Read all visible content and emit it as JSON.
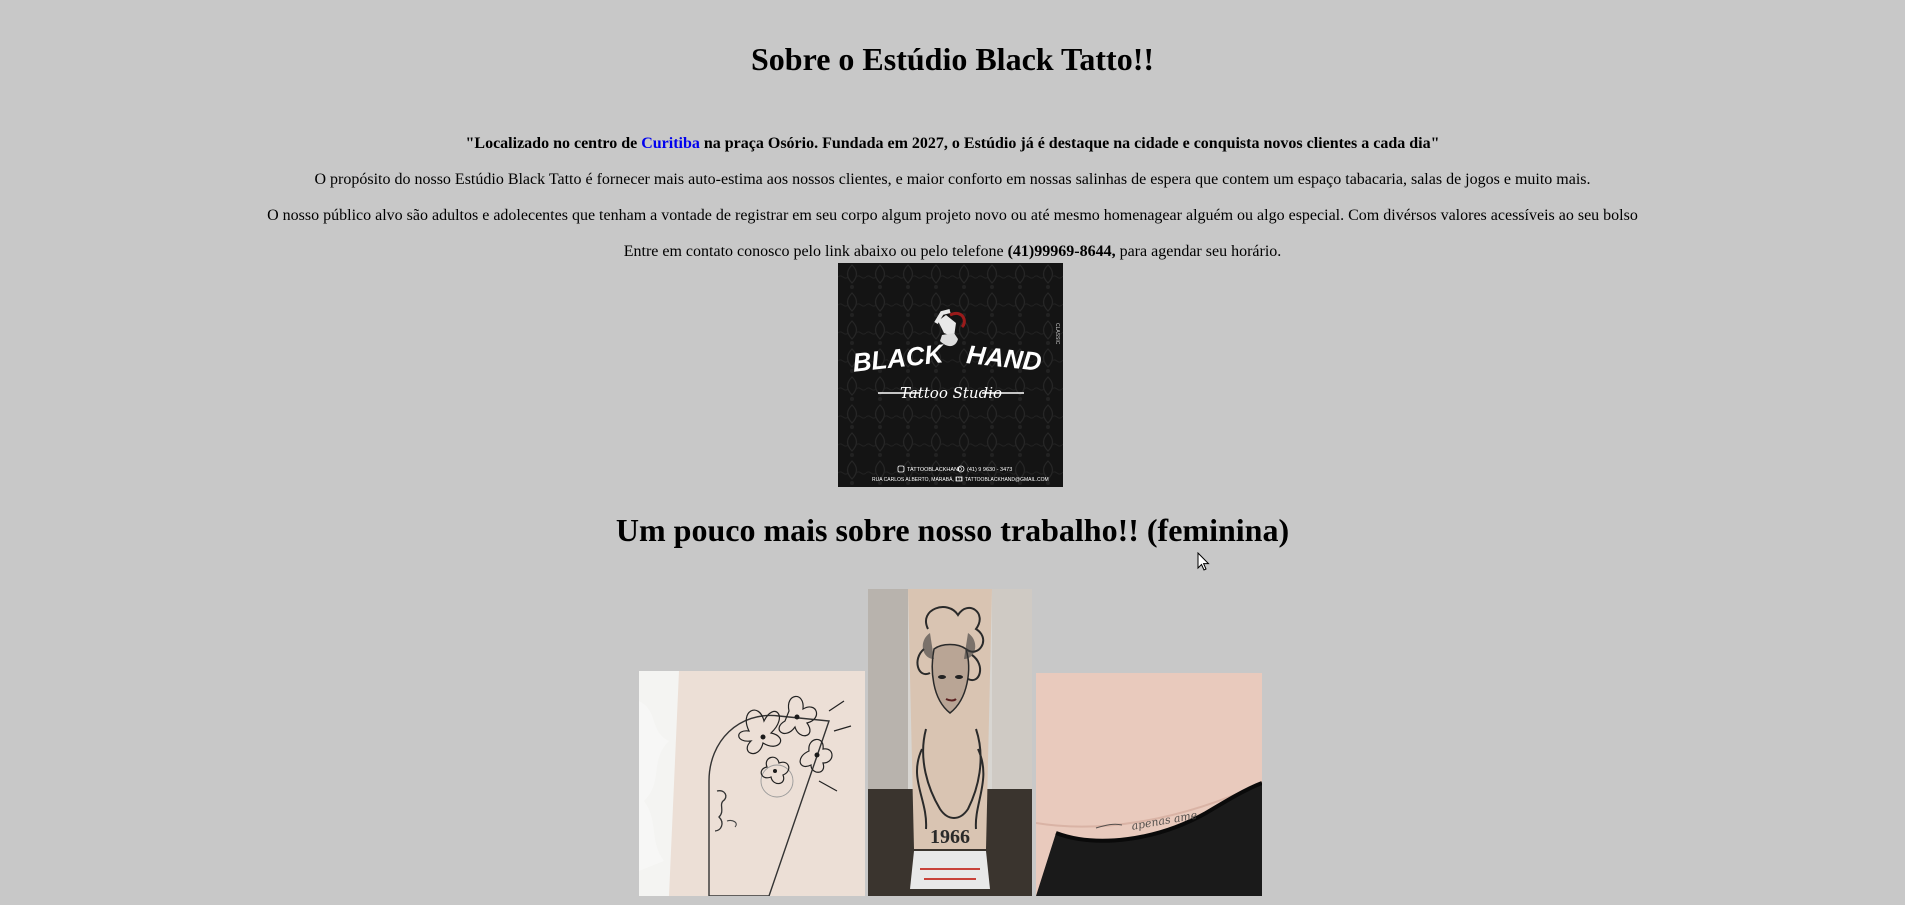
{
  "page": {
    "title": "Sobre o Estúdio Black Tatto!!",
    "intro_quote": {
      "before": "\"Localizado no centro de ",
      "link": "Curitiba",
      "after": " na praça Osório. Fundada em 2027, o Estúdio já é destaque na cidade e conquista novos clientes a cada dia\""
    },
    "purpose_text": "O propósito do nosso Estúdio Black Tatto é fornecer mais auto-estima aos nossos clientes, e maior conforto em nossas salinhas de espera que contem um espaço tabacaria, salas de jogos e muito mais.",
    "audience_text": "O nosso público alvo são adultos e adolecentes que tenham a vontade de registrar em seu corpo algum projeto novo ou até mesmo homenagear alguém ou algo especial. Com divérsos valores acessíveis ao seu bolso",
    "contact": {
      "before": "Entre em contato conosco pelo link abaixo ou pelo telefone ",
      "phone": "(41)99969-8644,",
      "after": " para agendar seu horário."
    },
    "logo": {
      "word_left": "BLACK",
      "word_right": "HAND",
      "tagline": "Tattoo Studio",
      "instagram": "TATTOOBLACKHAND",
      "whatsapp": "(41) 9 9630 - 3473",
      "address": "RUA CARLOS ALBERTO, MARABÁ, 111",
      "email": "TATTOOBLACKHAND@GMAIL.COM"
    },
    "section_title": "Um pouco mais sobre nosso trabalho!! (feminina)",
    "gallery": {
      "photo_2_year": "1966",
      "photo_3_script": "apenas ame"
    }
  }
}
